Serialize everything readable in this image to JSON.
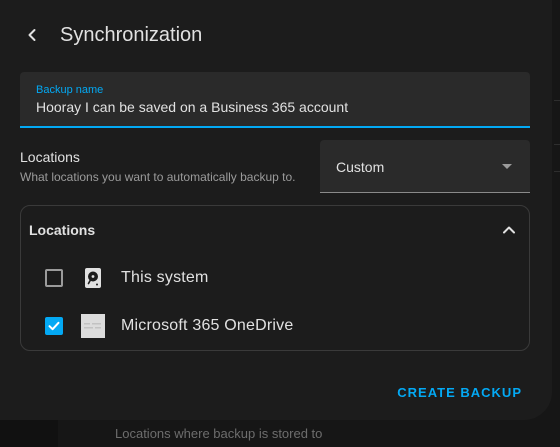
{
  "background": {
    "hint_text": "Locations where backup is stored to"
  },
  "dialog": {
    "title": "Synchronization",
    "backup_name": {
      "label": "Backup name",
      "value": "Hooray I can be saved on a Business 365 account"
    },
    "locations_setting": {
      "title": "Locations",
      "description": "What locations you want to automatically backup to.",
      "selected": "Custom"
    },
    "locations_panel": {
      "title": "Locations",
      "expanded": true,
      "items": [
        {
          "label": "This system",
          "checked": false,
          "icon": "hard-disk-icon"
        },
        {
          "label": "Microsoft 365 OneDrive",
          "checked": true,
          "icon": "onedrive-logo-icon"
        }
      ]
    },
    "actions": {
      "create_label": "CREATE BACKUP"
    }
  },
  "colors": {
    "accent": "#03a9f4",
    "surface": "#1c1c1c",
    "field": "#2a2a2a",
    "text": "#e1e1e1",
    "secondary_text": "#9b9b9b"
  }
}
